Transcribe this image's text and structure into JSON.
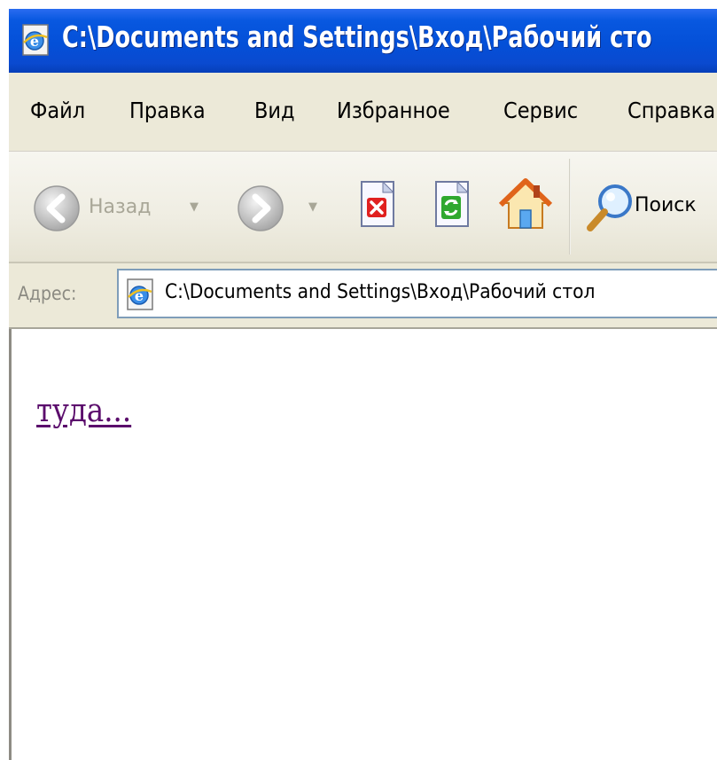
{
  "window": {
    "title": "C:\\Documents and Settings\\Вход\\Рабочий сто"
  },
  "menu": {
    "items": [
      "Файл",
      "Правка",
      "Вид",
      "Избранное",
      "Сервис",
      "Справка"
    ]
  },
  "toolbar": {
    "back_label": "Назад",
    "search_label": "Поиск",
    "icons": [
      "back-arrow-icon",
      "forward-arrow-icon",
      "stop-icon",
      "refresh-icon",
      "home-icon",
      "search-icon"
    ]
  },
  "address": {
    "label": "Адрес:",
    "value": "C:\\Documents and Settings\\Вход\\Рабочий стол"
  },
  "content": {
    "link_text": "туда..."
  },
  "colors": {
    "titlebar": "#0450d8",
    "menubar": "#ece9d8",
    "link_visited": "#5b0d6c"
  }
}
